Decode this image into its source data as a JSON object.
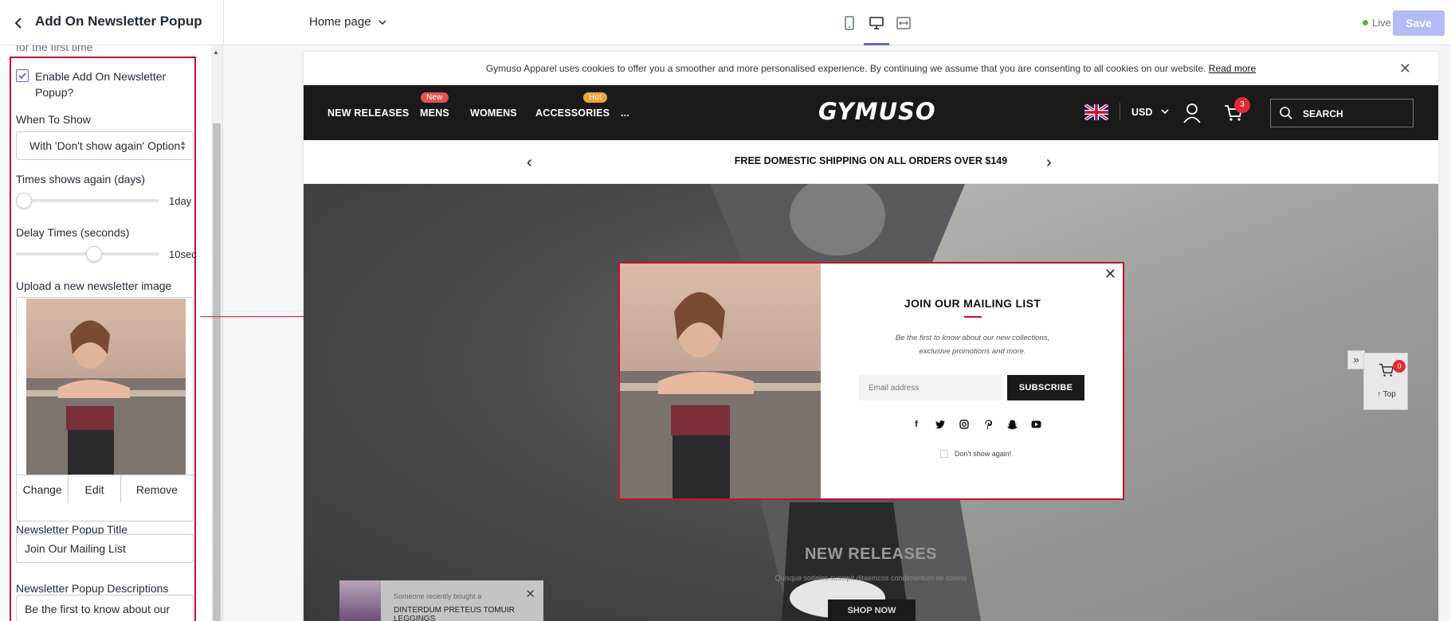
{
  "topbar": {
    "panel_title": "Add On Newsletter Popup",
    "page_selector": "Home page",
    "status": "Live",
    "save_label": "Save"
  },
  "panel": {
    "cut_text": "for the first time",
    "enable_label": "Enable Add On Newsletter Popup?",
    "enable_checked": true,
    "when_to_show_label": "When To Show",
    "when_to_show_value": "With 'Don't show again' Option",
    "times_again_label": "Times shows again (days)",
    "times_again_value": "1day",
    "times_again_level": 0.0,
    "delay_label": "Delay Times (seconds)",
    "delay_value": "10sec",
    "delay_level": 0.55,
    "upload_label": "Upload a new newsletter image",
    "change_label": "Change",
    "edit_label": "Edit",
    "remove_label": "Remove",
    "title_label": "Newsletter Popup Title",
    "title_value": "Join Our Mailing List",
    "desc_label": "Newsletter Popup Descriptions",
    "desc_value": "Be the first to know about our"
  },
  "store": {
    "cookie_text": "Gymuso Apparel uses cookies to offer you a smoother and more personalised experience. By continuing we assume that you are consenting to all cookies on our website.",
    "cookie_link": "Read more",
    "nav": [
      {
        "label": "NEW RELEASES"
      },
      {
        "label": "MENS",
        "badge": "New"
      },
      {
        "label": "WOMENS"
      },
      {
        "label": "ACCESSORIES",
        "badge": "Hot"
      },
      {
        "label": "..."
      }
    ],
    "logo": "GYMUSO",
    "currency": "USD",
    "cart_count": "3",
    "search_placeholder": "SEARCH",
    "shipping_text": "FREE DOMESTIC SHIPPING ON ALL ORDERS OVER $149",
    "hero_title": "NEW RELEASES",
    "hero_subtitle": "Quisque sodales suscipit ditaemcos condimentum de cosmo",
    "hero_button": "SHOP NOW",
    "side_cart_count": "0",
    "side_top_label": "Top",
    "recent_line1": "Someone recently bought a",
    "recent_line2": "DINTERDUM PRETEUS TOMUIR LEGGINGS"
  },
  "popup": {
    "title": "JOIN OUR MAILING LIST",
    "desc_line1": "Be the first to know about our new collections,",
    "desc_line2": "exclusive promotions and more.",
    "email_placeholder": "Email address",
    "subscribe_label": "SUBSCRIBE",
    "dont_show_label": "Don't show again!"
  },
  "colors": {
    "highlight": "#c4122f",
    "accent": "#5c6ac4",
    "badge_new": "#e2534f",
    "badge_hot": "#f1a33a",
    "cart_badge": "#e02a37"
  }
}
